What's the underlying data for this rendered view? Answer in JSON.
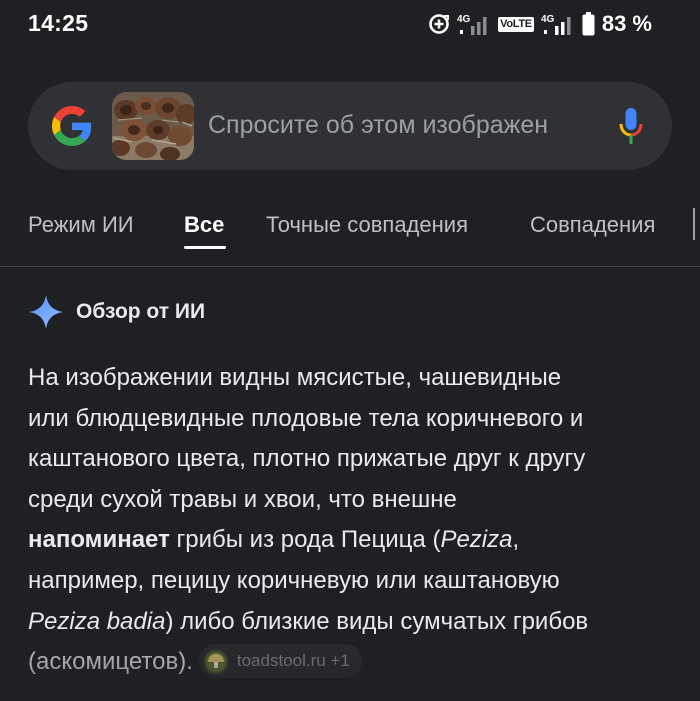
{
  "status_bar": {
    "time": "14:25",
    "network_1": "4G",
    "volte": "VoLTE",
    "network_2": "4G",
    "battery": "83 %",
    "icons": [
      "sync-icon",
      "signal-icon",
      "signal-icon",
      "battery-icon"
    ]
  },
  "search": {
    "placeholder": "Спросите об этом изображен",
    "logo": "google-logo",
    "mic": "mic-icon",
    "thumbnail": "query-image-thumbnail"
  },
  "tabs": [
    {
      "label": "Режим ИИ",
      "active": false
    },
    {
      "label": "Все",
      "active": true
    },
    {
      "label": "Точные совпадения",
      "active": false
    },
    {
      "label": "Совпадения",
      "active": false
    }
  ],
  "ai_overview": {
    "title": "Обзор от ИИ",
    "icon": "sparkle-icon",
    "text": {
      "l1": "На изображении видны мясистые, чашевидные",
      "l2": "или блюдцевидные плодовые тела коричневого и",
      "l3": "каштанового цвета, плотно прижатые друг к другу",
      "l4": "среди сухой травы и хвои, что внешне",
      "l5_bold": "напоминает",
      "l5_rest": " грибы из рода Пецица (",
      "l5_italic": "Peziza",
      "l5_end": ",",
      "l6": "например, пецицу коричневую или каштановую",
      "l7_italic": "Peziza badia",
      "l7_rest": ") либо близкие виды сумчатых грибов",
      "l8": "(аскомицетов)."
    },
    "source_chip": {
      "label": "toadstool.ru +1",
      "icon": "toadstool-favicon-icon"
    }
  },
  "colors": {
    "background": "#1f2023",
    "search_bg": "#303134",
    "text": "#e8eaed",
    "muted": "#9aa0a6",
    "google_blue": "#4285f4",
    "google_red": "#ea4335",
    "google_yellow": "#fbbc05",
    "google_green": "#34a853"
  }
}
